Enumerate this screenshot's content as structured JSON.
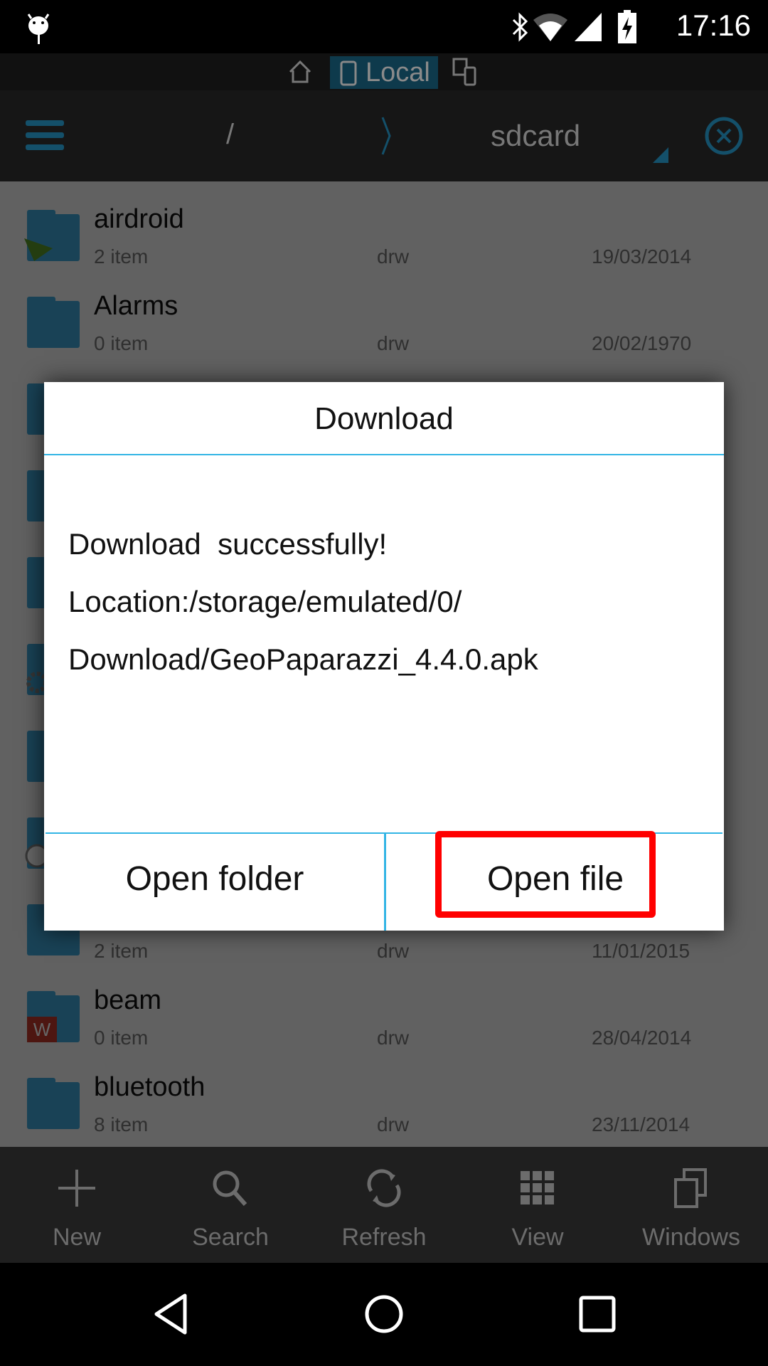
{
  "status_bar": {
    "time": "17:16",
    "icons": [
      "android-debug-icon",
      "bluetooth-icon",
      "wifi-icon",
      "signal-icon",
      "battery-charging-icon"
    ]
  },
  "location_tabs": {
    "home_icon": "home-icon",
    "active": "Local",
    "other_icon": "devices-icon"
  },
  "path_bar": {
    "root": "/",
    "current": "sdcard",
    "menu_icon": "menu-icon",
    "close_icon": "close-circle-icon"
  },
  "files": [
    {
      "name": "airdroid",
      "count": "2 item",
      "perm": "drw",
      "date": "19/03/2014",
      "badge": "airdroid"
    },
    {
      "name": "Alarms",
      "count": "0 item",
      "perm": "drw",
      "date": "20/02/1970"
    },
    {},
    {},
    {},
    {
      "badge": "gear"
    },
    {},
    {
      "badge": "circle"
    },
    {
      "count": "2 item",
      "perm": "drw",
      "date": "11/01/2015"
    },
    {
      "name": "beam",
      "count": "0 item",
      "perm": "drw",
      "date": "28/04/2014",
      "badge": "wps"
    },
    {
      "name": "bluetooth",
      "count": "8 item",
      "perm": "drw",
      "date": "23/11/2014"
    }
  ],
  "toolbar": [
    {
      "label": "New",
      "icon": "plus-icon"
    },
    {
      "label": "Search",
      "icon": "search-icon"
    },
    {
      "label": "Refresh",
      "icon": "refresh-icon"
    },
    {
      "label": "View",
      "icon": "grid-icon"
    },
    {
      "label": "Windows",
      "icon": "windows-icon"
    }
  ],
  "dialog": {
    "title": "Download",
    "lines": [
      "Download  successfully!",
      "Location:/storage/emulated/0/",
      "Download/GeoPaparazzi_4.4.0.apk"
    ],
    "open_folder": "Open folder",
    "open_file": "Open file"
  },
  "colors": {
    "accent": "#33b5e5",
    "highlight": "#ff0000",
    "folder": "#3fa6d6"
  }
}
